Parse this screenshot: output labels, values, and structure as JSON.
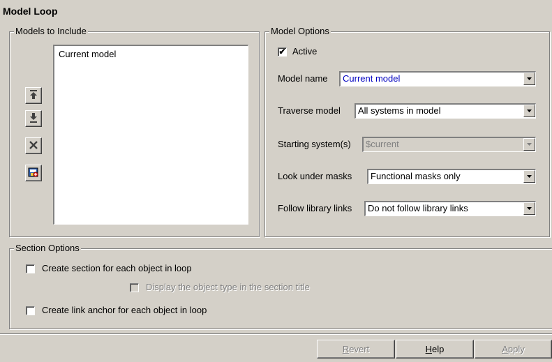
{
  "title": "Model Loop",
  "models_group": {
    "legend": "Models to Include",
    "items": [
      "Current model"
    ]
  },
  "model_options": {
    "legend": "Model Options",
    "active": {
      "label": "Active",
      "checked": true,
      "mark": "✔"
    },
    "model_name": {
      "label": "Model name",
      "value": "Current model"
    },
    "traverse_model": {
      "label": "Traverse model",
      "value": "All systems in model"
    },
    "starting_systems": {
      "label": "Starting system(s)",
      "value": "$current"
    },
    "look_under_masks": {
      "label": "Look under masks",
      "value": "Functional masks only"
    },
    "follow_library_links": {
      "label": "Follow library links",
      "value": "Do not follow library links"
    }
  },
  "section_options": {
    "legend": "Section Options",
    "create_section": {
      "label": "Create section for each object in loop",
      "checked": false
    },
    "display_type": {
      "label": "Display the object type in the section title",
      "checked": false
    },
    "create_anchor": {
      "label": "Create link anchor for each object in loop",
      "checked": false
    }
  },
  "buttons": {
    "revert": {
      "mnemonic": "R",
      "rest": "evert"
    },
    "help": {
      "mnemonic": "H",
      "rest": "elp"
    },
    "apply": {
      "mnemonic": "A",
      "rest": "pply"
    }
  },
  "icons": {
    "move_up": "move-up-icon",
    "move_down": "move-down-icon",
    "delete": "delete-icon",
    "add_model": "add-model-icon",
    "dropdown": "chevron-down-icon"
  },
  "colors": {
    "face": "#d4d0c8",
    "shadow": "#808080",
    "highlight": "#ffffff",
    "value_text": "#0000c0",
    "disabled_text": "#808080"
  }
}
